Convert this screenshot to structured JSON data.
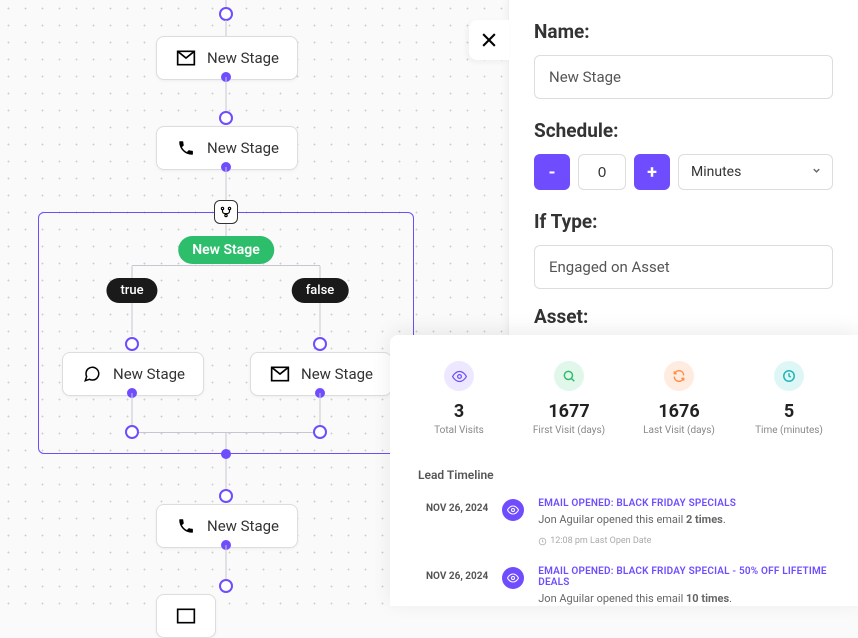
{
  "canvas": {
    "node1_label": "New Stage",
    "node2_label": "New Stage",
    "node3_label": "New Stage",
    "node4_label": "New Stage",
    "node5_label": "New Stage",
    "branch_label": "New Stage",
    "branch_true": "true",
    "branch_false": "false"
  },
  "panel": {
    "name_label": "Name:",
    "name_value": "New Stage",
    "schedule_label": "Schedule:",
    "schedule_value": "0",
    "schedule_unit": "Minutes",
    "iftype_label": "If Type:",
    "iftype_value": "Engaged on Asset",
    "asset_label": "Asset:"
  },
  "overlay": {
    "stats": [
      {
        "value": "3",
        "label": "Total Visits"
      },
      {
        "value": "1677",
        "label": "First Visit (days)"
      },
      {
        "value": "1676",
        "label": "Last Visit (days)"
      },
      {
        "value": "5",
        "label": "Time (minutes)"
      }
    ],
    "timeline_title": "Lead Timeline",
    "items": [
      {
        "date": "NOV 26, 2024",
        "title": "EMAIL OPENED: BLACK FRIDAY SPECIALS",
        "sub_pre": "Jon Aguilar opened this email ",
        "sub_bold": "2 times",
        "meta": "12:08 pm Last Open Date"
      },
      {
        "date": "NOV 26, 2024",
        "title": "EMAIL OPENED: BLACK FRIDAY SPECIAL - 50% OFF LIFETIME DEALS",
        "sub_pre": "Jon Aguilar opened this email ",
        "sub_bold": "10 times",
        "meta": ""
      }
    ]
  }
}
